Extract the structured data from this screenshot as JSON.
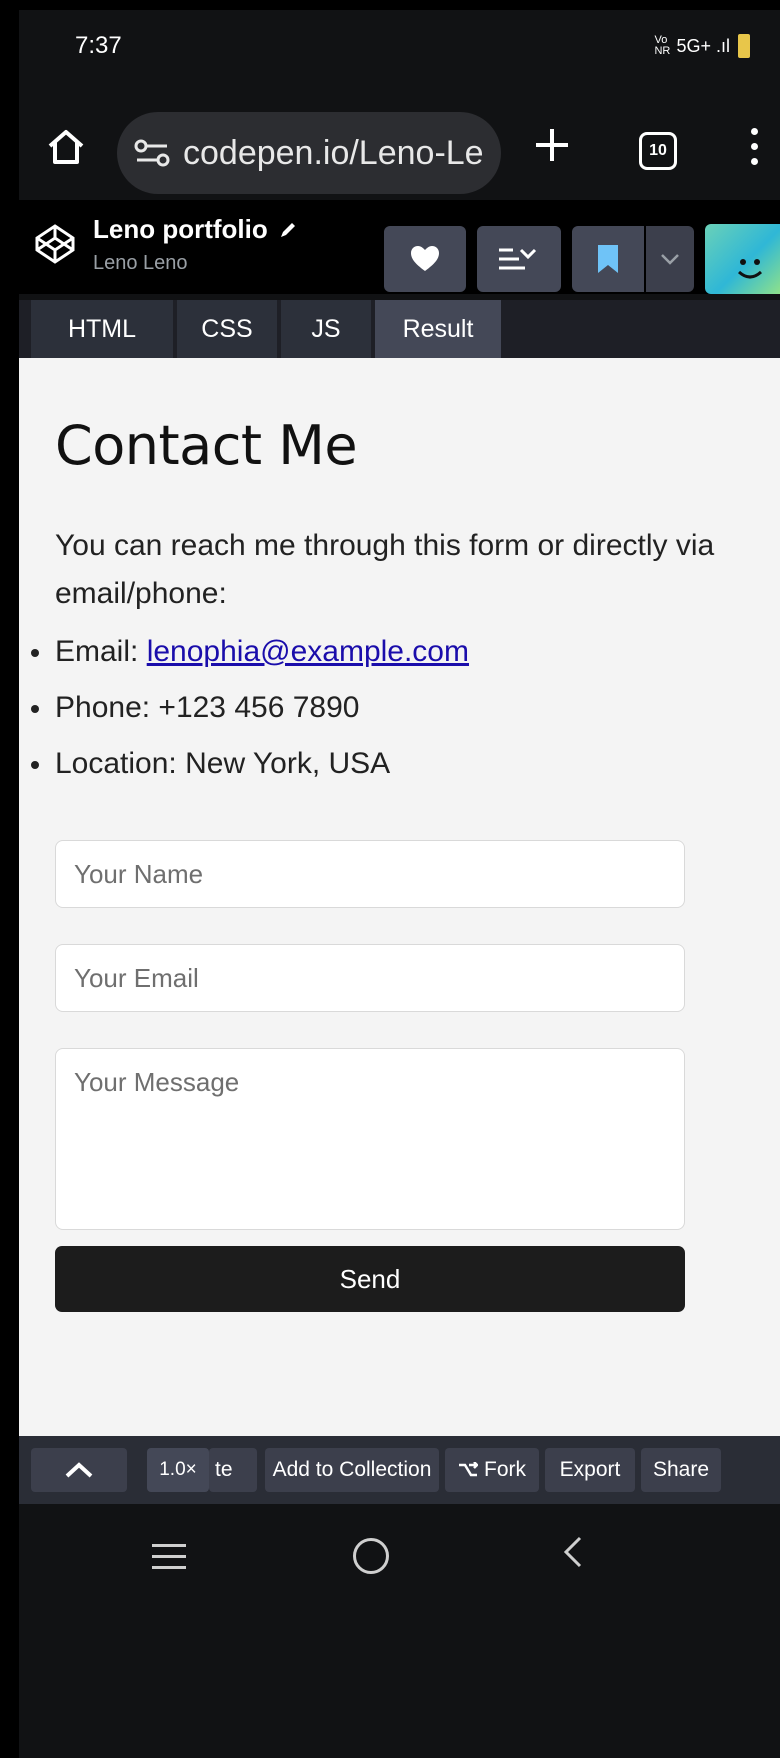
{
  "status_bar": {
    "time": "7:37",
    "indicators": "5G+ .ıl",
    "volte": "Vo NR"
  },
  "browser": {
    "url": "codepen.io/Leno-Le",
    "tab_count": "10"
  },
  "codepen": {
    "pen_title": "Leno portfolio",
    "author": "Leno Leno",
    "tabs": [
      "HTML",
      "CSS",
      "JS",
      "Result"
    ],
    "active_tab": "Result"
  },
  "page": {
    "heading": "Contact Me",
    "intro": "You can reach me through this form or directly via email/phone:",
    "email_label": "Email: ",
    "email": "lenophia@example.com",
    "phone": "Phone: +123 456 7890",
    "location": "Location: New York, USA",
    "form": {
      "name_placeholder": "Your Name",
      "email_placeholder": "Your Email",
      "message_placeholder": "Your Message",
      "send_label": "Send"
    }
  },
  "toolbar": {
    "zoom": "1.0×",
    "delete_fragment": "te",
    "add_to_collection": "Add to Collection",
    "fork": "Fork",
    "export": "Export",
    "share": "Share"
  },
  "colors": {
    "page_bg": "#f4f4f4",
    "send_button_bg": "#1c1c1c",
    "link": "#1a0dab",
    "codepen_button": "#444857"
  }
}
